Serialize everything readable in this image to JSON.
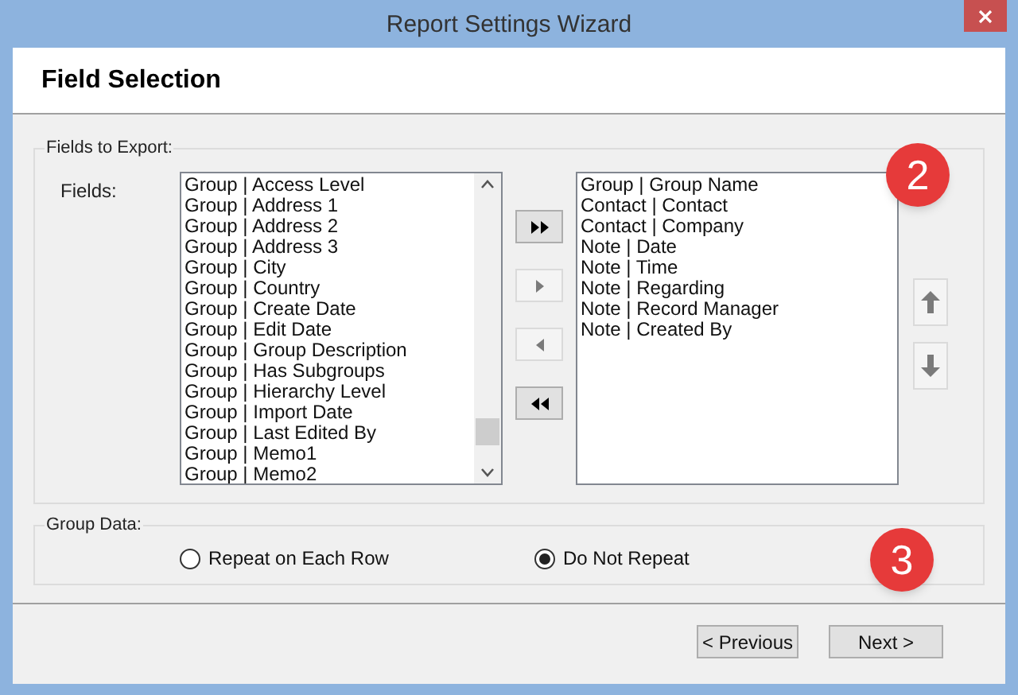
{
  "window": {
    "title": "Report Settings Wizard"
  },
  "header": {
    "title": "Field Selection"
  },
  "fields_group": {
    "title": "Fields to Export:",
    "fields_label": "Fields:",
    "available": [
      "Group | Access Level",
      "Group | Address 1",
      "Group | Address 2",
      "Group | Address 3",
      "Group | City",
      "Group | Country",
      "Group | Create Date",
      "Group | Edit Date",
      "Group | Group Description",
      "Group | Has Subgroups",
      "Group | Hierarchy Level",
      "Group | Import Date",
      "Group | Last Edited By",
      "Group | Memo1",
      "Group | Memo2"
    ],
    "move_buttons": [
      {
        "kind": "add_all",
        "disabled": false
      },
      {
        "kind": "add",
        "disabled": true
      },
      {
        "kind": "remove",
        "disabled": true
      },
      {
        "kind": "remove_all",
        "disabled": false
      }
    ],
    "selected_fields": [
      "Group | Group Name",
      "Contact | Contact",
      "Contact | Company",
      "Note | Date",
      "Note | Time",
      "Note | Regarding",
      "Note | Record Manager",
      "Note | Created By"
    ],
    "order_buttons": [
      {
        "kind": "up",
        "disabled": true
      },
      {
        "kind": "down",
        "disabled": true
      }
    ]
  },
  "group_data": {
    "title": "Group Data:",
    "options": [
      {
        "label": "Repeat on Each Row",
        "selected": false
      },
      {
        "label": "Do Not Repeat",
        "selected": true
      }
    ]
  },
  "badges": [
    "2",
    "3"
  ],
  "buttons": [
    "< Previous",
    "Next >"
  ]
}
